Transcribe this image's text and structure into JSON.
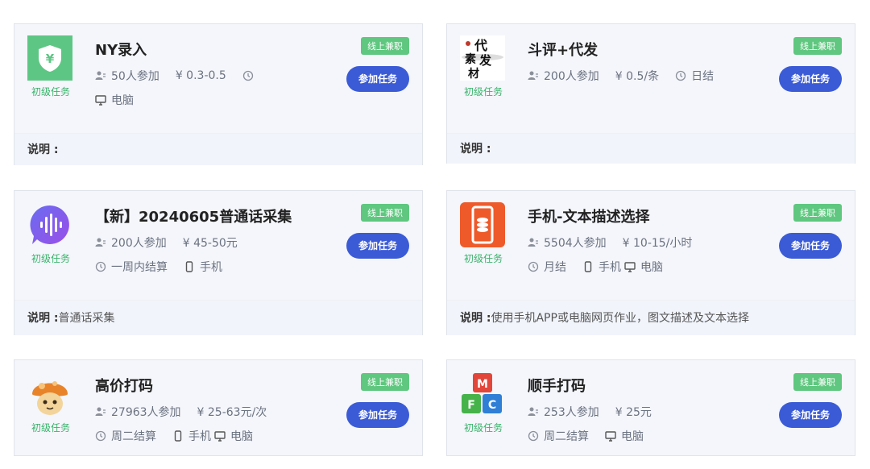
{
  "cards": [
    {
      "title": "NY录入",
      "level": "初级任务",
      "tag": "线上兼职",
      "button": "参加任务",
      "participants": "50人参加",
      "pay": "¥ 0.3-0.5",
      "settle": "",
      "device": "电脑",
      "desc_label": "说明 :",
      "desc_text": "",
      "logo_icon": "shield-yen-icon"
    },
    {
      "title": "斗评+代发",
      "level": "初级任务",
      "tag": "线上兼职",
      "button": "参加任务",
      "participants": "200人参加",
      "pay": "¥ 0.5/条",
      "settle": "日结",
      "device": "",
      "desc_label": "说明 :",
      "desc_text": "",
      "logo_text": "代素发材",
      "logo_icon": "calligraphy-logo"
    },
    {
      "title": "【新】20240605普通话采集",
      "level": "初级任务",
      "tag": "线上兼职",
      "button": "参加任务",
      "participants": "200人参加",
      "pay": "¥ 45-50元",
      "settle": "一周内结算",
      "device": "手机",
      "desc_label": "说明 :",
      "desc_text": "普通话采集",
      "logo_icon": "voice-wave-icon"
    },
    {
      "title": "手机-文本描述选择",
      "level": "初级任务",
      "tag": "线上兼职",
      "button": "参加任务",
      "participants": "5504人参加",
      "pay": "¥ 10-15/小时",
      "settle": "月结",
      "device": "手机",
      "device2": "电脑",
      "desc_label": "说明 :",
      "desc_text": "使用手机APP或电脑网页作业，图文描述及文本选择",
      "logo_icon": "phone-coins-icon"
    },
    {
      "title": "高价打码",
      "level": "初级任务",
      "tag": "线上兼职",
      "button": "参加任务",
      "participants": "27963人参加",
      "pay": "¥ 25-63元/次",
      "settle": "周二结算",
      "device": "手机",
      "device2": "电脑",
      "logo_icon": "mushroom-icon"
    },
    {
      "title": "顺手打码",
      "level": "初级任务",
      "tag": "线上兼职",
      "button": "参加任务",
      "participants": "253人参加",
      "pay": "¥ 25元",
      "settle": "周二结算",
      "device": "电脑",
      "logo_letters": [
        "M",
        "F",
        "C"
      ],
      "logo_icon": "mfc-cubes-icon"
    }
  ],
  "colors": {
    "accent": "#3b5bd6",
    "tag": "#5fc77f",
    "level": "#39b36a",
    "card_bg": "#f4f6fb"
  }
}
